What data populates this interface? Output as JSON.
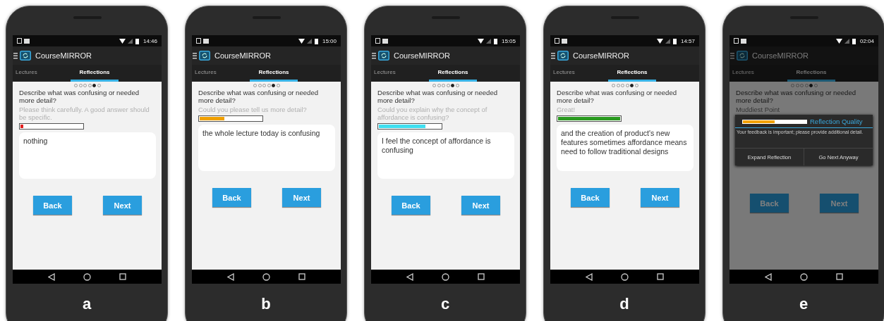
{
  "phones": [
    {
      "label": "a",
      "time": "14:46",
      "app_title": "CourseMIRROR",
      "tabs": [
        {
          "label": "Lectures",
          "selected": false
        },
        {
          "label": "Reflections",
          "selected": true
        }
      ],
      "pager": [
        {
          "selected": false
        },
        {
          "selected": false
        },
        {
          "selected": false
        },
        {
          "selected": false
        },
        {
          "selected": true
        },
        {
          "selected": false
        }
      ],
      "question": "Describe what was confusing or needed more detail?",
      "hint": "Please think carefully. A good answer should be specific.",
      "quality": {
        "level": 0.05,
        "color": "#e02020"
      },
      "answer": "nothing",
      "buttons": [
        "Back",
        "Next"
      ]
    },
    {
      "label": "b",
      "time": "15:00",
      "app_title": "CourseMIRROR",
      "tabs": [
        {
          "label": "Lectures",
          "selected": false
        },
        {
          "label": "Reflections",
          "selected": true
        }
      ],
      "pager": [
        {
          "selected": false
        },
        {
          "selected": false
        },
        {
          "selected": false
        },
        {
          "selected": false
        },
        {
          "selected": true
        },
        {
          "selected": false
        }
      ],
      "question": "Describe what was confusing or needed more detail?",
      "hint": "Could you please tell us more detail?",
      "quality": {
        "level": 0.4,
        "color": "#f0a000"
      },
      "answer": "the whole lecture today is confusing",
      "buttons": [
        "Back",
        "Next"
      ]
    },
    {
      "label": "c",
      "time": "15:05",
      "app_title": "CourseMIRROR",
      "tabs": [
        {
          "label": "Lectures",
          "selected": false
        },
        {
          "label": "Reflections",
          "selected": true
        }
      ],
      "pager": [
        {
          "selected": false
        },
        {
          "selected": false
        },
        {
          "selected": false
        },
        {
          "selected": false
        },
        {
          "selected": true
        },
        {
          "selected": false
        }
      ],
      "question": "Describe what was confusing or needed more detail?",
      "hint": "Could you explain why the concept of affordance is confusing?",
      "quality": {
        "level": 0.75,
        "color": "#40dff0"
      },
      "answer": "I feel the concept of affordance is confusing",
      "buttons": [
        "Back",
        "Next"
      ]
    },
    {
      "label": "d",
      "time": "14:57",
      "app_title": "CourseMIRROR",
      "tabs": [
        {
          "label": "Lectures",
          "selected": false
        },
        {
          "label": "Reflections",
          "selected": true
        }
      ],
      "pager": [
        {
          "selected": false
        },
        {
          "selected": false
        },
        {
          "selected": false
        },
        {
          "selected": false
        },
        {
          "selected": true
        },
        {
          "selected": false
        }
      ],
      "question": "Describe what was confusing or needed more detail?",
      "hint": "Great!",
      "quality": {
        "level": 1.0,
        "color": "#2a9a20"
      },
      "answer": "and the creation of product's new features sometimes affordance means need to follow traditional designs",
      "buttons": [
        "Back",
        "Next"
      ]
    },
    {
      "label": "e",
      "time": "02:04",
      "app_title": "CourseMIRROR",
      "tabs": [
        {
          "label": "Lectures",
          "selected": false
        },
        {
          "label": "Reflections",
          "selected": true
        }
      ],
      "pager": [
        {
          "selected": false
        },
        {
          "selected": false
        },
        {
          "selected": false
        },
        {
          "selected": false
        },
        {
          "selected": true
        },
        {
          "selected": false
        }
      ],
      "question": "Describe what was confusing or needed more detail?",
      "hint": "Muddiest Point",
      "buttons": [
        "Back",
        "Next"
      ],
      "dialog": {
        "title": "Reflection Quality",
        "quality": {
          "level": 0.5,
          "color": "#f0a000"
        },
        "message": "Your feedback is important; please provide additional detail.",
        "buttons": [
          "Expand Reflection",
          "Go Next Anyway"
        ]
      }
    }
  ]
}
